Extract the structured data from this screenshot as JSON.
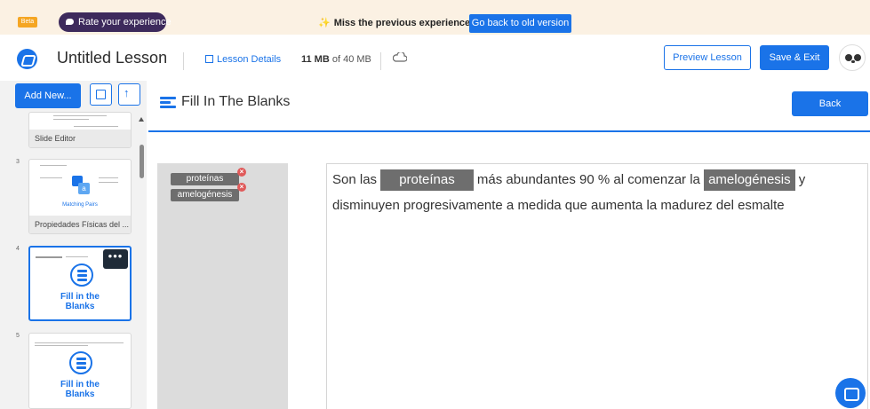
{
  "banner": {
    "beta_label": "Beta",
    "rate_label": "Rate your experience",
    "miss_text": "Miss the previous experience?",
    "old_version_label": "Go back to old version"
  },
  "header": {
    "lesson_title": "Untitled Lesson",
    "lesson_details_label": "Lesson Details",
    "storage_used": "11 MB",
    "storage_total": "of 40 MB",
    "preview_label": "Preview Lesson",
    "save_exit_label": "Save & Exit"
  },
  "sidebar": {
    "add_new_label": "Add New...",
    "slides": [
      {
        "number": "",
        "label": "Slide Editor"
      },
      {
        "number": "3",
        "label": "Propiedades Físicas del ...",
        "preview_text": "Matching Pairs"
      },
      {
        "number": "4",
        "title_line1": "Fill in the",
        "title_line2": "Blanks",
        "more_label": "•••"
      },
      {
        "number": "5",
        "title_line1": "Fill in the",
        "title_line2": "Blanks"
      }
    ]
  },
  "main": {
    "section_title": "Fill In The Blanks",
    "back_label": "Back",
    "word_bank": [
      "proteínas",
      "amelogénesis"
    ],
    "remove_glyph": "×",
    "sentence": {
      "part1": "Son las ",
      "blank1": "proteínas",
      "part2": " más abundantes 90 % al comenzar la ",
      "blank2": "amelogénesis",
      "part3": " y disminuyen progresivamente a medida que aumenta la madurez del esmalte"
    }
  },
  "colors": {
    "accent": "#1a73e8",
    "banner_bg": "#fbf1e3",
    "blank_bg": "#6e6e6e"
  }
}
